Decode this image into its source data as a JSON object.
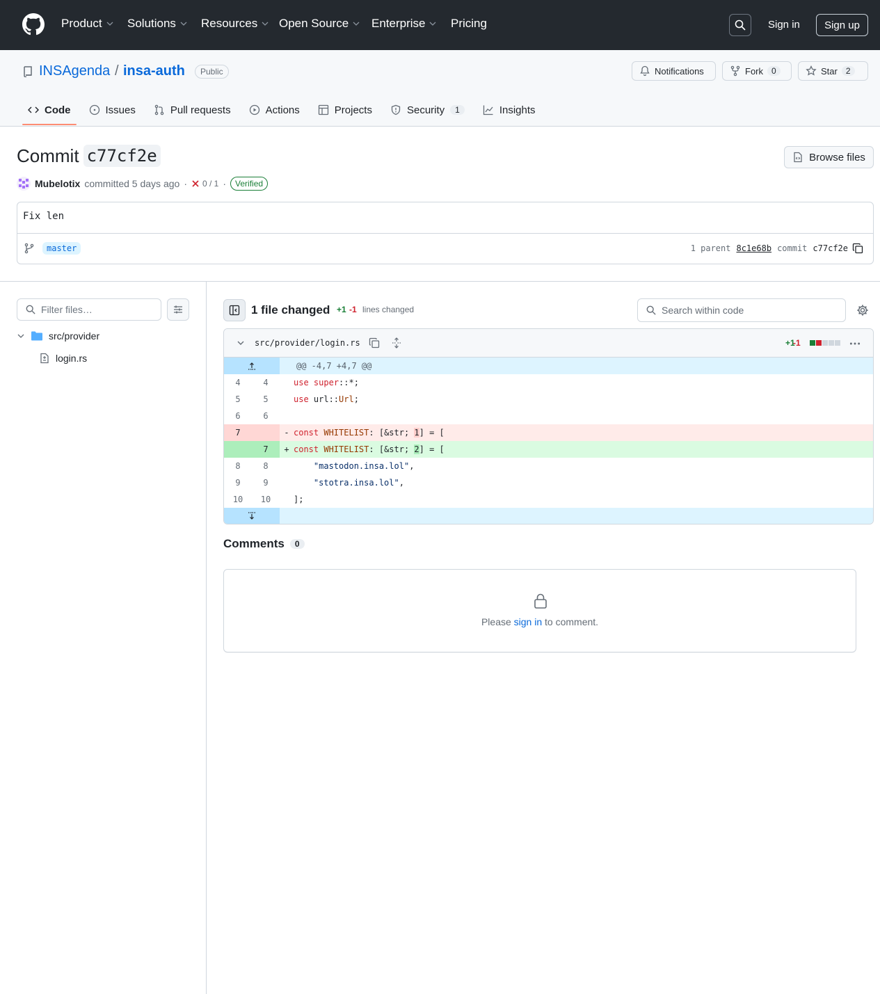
{
  "nav": {
    "items": [
      "Product",
      "Solutions",
      "Resources",
      "Open Source",
      "Enterprise",
      "Pricing"
    ],
    "sign_in": "Sign in",
    "sign_up": "Sign up"
  },
  "repo": {
    "owner": "INSAgenda",
    "separator": "/",
    "name": "insa-auth",
    "visibility": "Public",
    "notifications": "Notifications",
    "fork_label": "Fork",
    "fork_count": "0",
    "star_label": "Star",
    "star_count": "2"
  },
  "tabs": [
    {
      "label": "Code"
    },
    {
      "label": "Issues"
    },
    {
      "label": "Pull requests"
    },
    {
      "label": "Actions"
    },
    {
      "label": "Projects"
    },
    {
      "label": "Security",
      "count": "1"
    },
    {
      "label": "Insights"
    }
  ],
  "commit": {
    "title_prefix": "Commit",
    "sha": "c77cf2e",
    "browse_files": "Browse files",
    "author": "Mubelotix",
    "committed": "committed 5 days ago",
    "dot": "·",
    "checks": "0 / 1",
    "verified": "Verified",
    "message": "Fix len",
    "branch": "master",
    "parent_label": "1 parent",
    "parent_sha": "8c1e68b",
    "commit_label": "commit",
    "commit_sha": "c77cf2e"
  },
  "sidebar": {
    "filter_placeholder": "Filter files…",
    "dir": "src/provider",
    "file": "login.rs"
  },
  "diff": {
    "summary": "1 file changed",
    "additions": "+1",
    "deletions": "-1",
    "lines_changed": "lines changed",
    "search_placeholder": "Search within code",
    "file_path": "src/provider/login.rs",
    "file_add": "+1",
    "file_del": "-1",
    "hunk": "@@ -4,7 +4,7 @@",
    "colors": {
      "add": "#1a7f37",
      "del": "#cf222e",
      "neutral": "#d0d7de"
    }
  },
  "comments": {
    "title": "Comments",
    "count": "0",
    "please": "Please",
    "sign_in": "sign in",
    "to_comment": "to comment."
  }
}
